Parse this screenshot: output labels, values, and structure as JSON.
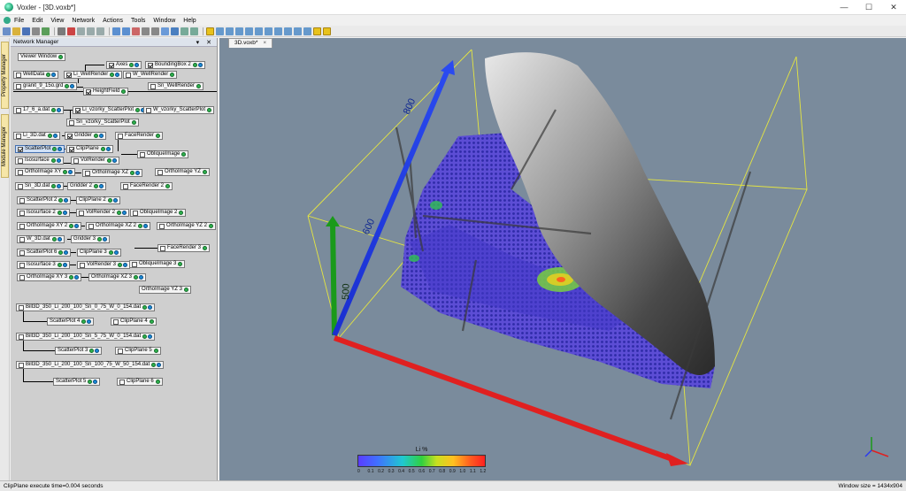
{
  "window": {
    "title": "Voxler - [3D.voxb*]",
    "controls": [
      "—",
      "☐",
      "✕"
    ]
  },
  "menu": [
    "File",
    "Edit",
    "View",
    "Network",
    "Actions",
    "Tools",
    "Window",
    "Help"
  ],
  "side_tabs": [
    "Property Manager",
    "Module Manager"
  ],
  "network_manager": {
    "title": "Network Manager",
    "header_buttons": "▾ ✕",
    "nodes": {
      "viewer_window": "Viewer Window",
      "axes": "Axes",
      "bounding_box": "BoundingBox 2",
      "welldata": "WellData",
      "li_wellrender": "Li_WellRender",
      "w_wellrender": "W_WellRender",
      "granit": "granit_9_15o.grd",
      "sn_wellrender": "Sn_WellRender",
      "heightfield": "HeightField",
      "a17": "17_6_a.dat",
      "li_vzorky": "Li_vzorky_ScatterPlot",
      "w_vzorky": "W_vzorky_ScatterPlot",
      "sn_vzorky": "Sn_vzorky_ScatterPlot",
      "li_3d": "Li_3D.dat",
      "gridder": "Gridder",
      "facerender": "FaceRender",
      "scatterplot": "ScatterPlot",
      "clipplane": "ClipPlane",
      "obliqueimage": "ObliqueImage",
      "isosurface": "Isosurface",
      "volrender": "VolRender",
      "orthoxy": "OrthoImage XY",
      "orthoxz": "OrthoImage XZ",
      "orthoyz": "OrthoImage YZ",
      "sn_3d": "Sn_3D.dat",
      "gridder2": "Gridder 2",
      "facerender2": "FaceRender 2",
      "scatterplot2": "ScatterPlot 2",
      "clipplane2": "ClipPlane 2",
      "isosurface2": "Isosurface 2",
      "volrender2": "VolRender 2",
      "obliqueimage2": "ObliqueImage 2",
      "orthoxy2": "OrthoImage XY 2",
      "orthoxz2": "OrthoImage XZ 2",
      "orthoyz2": "OrthoImage YZ 2",
      "w_3d": "W_3D.dat",
      "gridder3": "Gridder 3",
      "facerender3": "FaceRender 3",
      "scatterplot6": "ScatterPlot 6",
      "clipplane3": "ClipPlane 3",
      "isosurface3": "Isosurface 3",
      "volrender3": "VolRender 3",
      "obliqueimage3": "ObliqueImage 3",
      "orthoxy3": "OrthoImage XY 3",
      "orthoxz3": "OrthoImage XZ 3",
      "orthoyz3": "OrthoImage YZ 3",
      "bill1": "Bill3D_350_Li_200_100_Sn_0_75_W_0_154.dat",
      "scatterplot4": "ScatterPlot 4",
      "clipplane4": "ClipPlane 4",
      "bill2": "Bill3D_350_Li_200_100_Sn_5_75_W_0_154.dat",
      "scatterplot3": "ScatterPlot 3",
      "clipplane5": "ClipPlane 5",
      "bill3": "Bill3D_350_Li_200_100_Sn_100_75_W_50_154.dat",
      "scatterplot5": "ScatterPlot 5",
      "clipplane6": "ClipPlane 6"
    }
  },
  "document_tab": {
    "label": "3D.voxb*",
    "close": "×"
  },
  "viewer": {
    "axis_labels": {
      "y_top": "800",
      "y_mid": "600",
      "z": "500"
    },
    "legend": {
      "title": "Li %",
      "ticks": [
        "0",
        "0.1",
        "0.2",
        "0.3",
        "0.4",
        "0.5",
        "0.6",
        "0.7",
        "0.8",
        "0.9",
        "1.0",
        "1.1",
        "1.2"
      ]
    }
  },
  "status": {
    "left": "ClipPlane execute time=0.004 seconds",
    "right": "Window size = 1434x904"
  }
}
